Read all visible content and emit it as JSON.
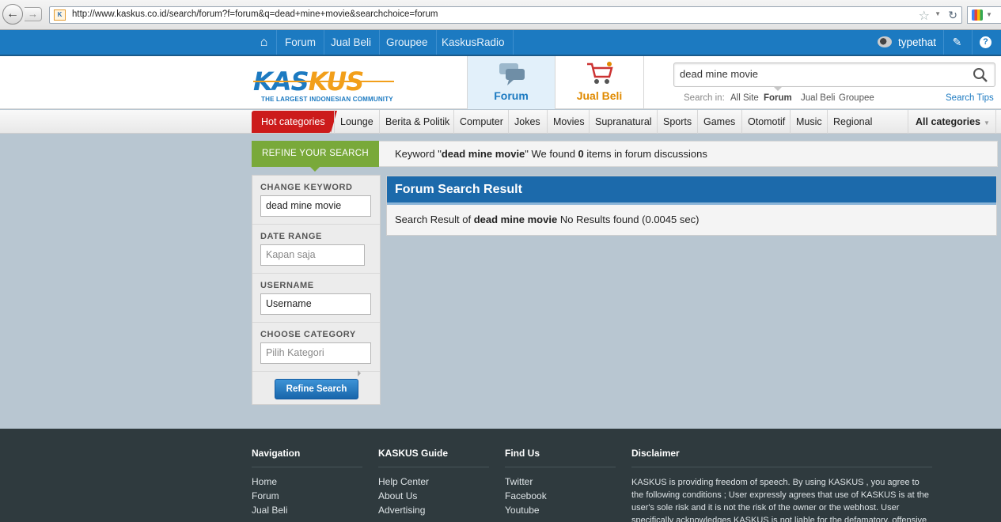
{
  "browser": {
    "url": "http://www.kaskus.co.id/search/forum?f=forum&q=dead+mine+movie&searchchoice=forum",
    "favicon": "K"
  },
  "topnav": {
    "links": [
      "Forum",
      "Jual Beli",
      "Groupee",
      "KaskusRadio"
    ],
    "username": "typethat"
  },
  "header": {
    "logo_part1": "KAS",
    "logo_part2": "KUS",
    "logo_tagline": "THE LARGEST INDONESIAN COMMUNITY",
    "tab_forum": "Forum",
    "tab_jualbeli": "Jual Beli",
    "search_value": "dead mine movie",
    "search_in_label": "Search in:",
    "search_in_options": [
      "All Site",
      "Forum",
      "Jual Beli",
      "Groupee"
    ],
    "search_in_active": "Forum",
    "search_tips": "Search Tips"
  },
  "categories": {
    "hot": "Hot categories",
    "items": [
      "Lounge",
      "Berita & Politik",
      "Computer",
      "Jokes",
      "Movies",
      "Supranatural",
      "Sports",
      "Games",
      "Otomotif",
      "Music",
      "Regional"
    ],
    "all": "All categories"
  },
  "refine": {
    "tab_label": "REFINE YOUR SEARCH",
    "keyword_prefix": "Keyword \"",
    "keyword": "dead mine movie",
    "keyword_mid": "\" We found ",
    "count": "0",
    "keyword_suffix": " items in forum discussions"
  },
  "sidebar": {
    "keyword_label": "CHANGE KEYWORD",
    "keyword_value": "dead mine movie",
    "date_label": "DATE RANGE",
    "date_placeholder": "Kapan saja",
    "username_label": "USERNAME",
    "username_value": "Username",
    "category_label": "CHOOSE CATEGORY",
    "category_placeholder": "Pilih Kategori",
    "button": "Refine Search"
  },
  "results": {
    "title": "Forum Search Result",
    "prefix": "Search Result of ",
    "keyword": "dead mine movie",
    "suffix": " No Results found (0.0045 sec)"
  },
  "footer": {
    "nav_title": "Navigation",
    "nav_links": [
      "Home",
      "Forum",
      "Jual Beli"
    ],
    "guide_title": "KASKUS Guide",
    "guide_links": [
      "Help Center",
      "About Us",
      "Advertising"
    ],
    "find_title": "Find Us",
    "find_links": [
      "Twitter",
      "Facebook",
      "Youtube"
    ],
    "disclaimer_title": "Disclaimer",
    "disclaimer_text": "KASKUS is providing freedom of speech. By using KASKUS , you agree to the following conditions ; User expressly agrees that use of KASKUS is at the user's sole risk and it is not the risk of the owner or the webhost. User specifically acknowledges KASKUS is not liable for the defamatory, offensive"
  },
  "colors": {
    "brand_blue": "#1c7ac1",
    "brand_orange": "#f29f1a",
    "hot_red": "#cc1b1b",
    "refine_green": "#79a93a"
  }
}
